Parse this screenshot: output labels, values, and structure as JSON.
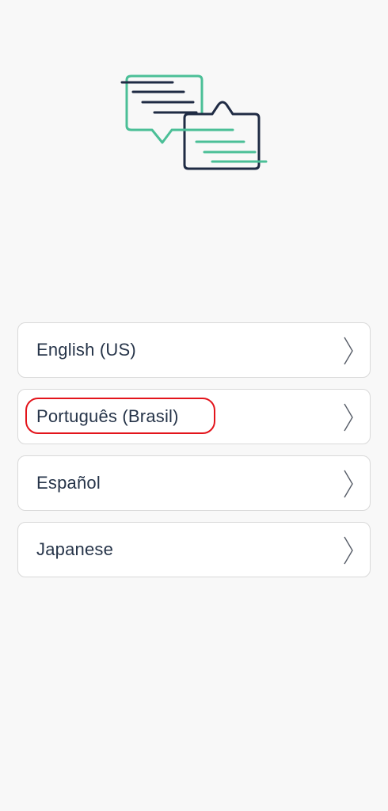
{
  "illustration": {
    "icon": "translate-chat-bubbles-icon",
    "colors": {
      "green": "#4bbf97",
      "navy": "#1f2b44"
    }
  },
  "languages": [
    {
      "label": "English (US)"
    },
    {
      "label": "Português (Brasil)",
      "highlighted": true
    },
    {
      "label": "Español"
    },
    {
      "label": "Japanese"
    }
  ],
  "colors": {
    "background": "#f8f8f8",
    "text": "#263449",
    "border": "#d9d9d9",
    "highlight": "#e3141b"
  }
}
